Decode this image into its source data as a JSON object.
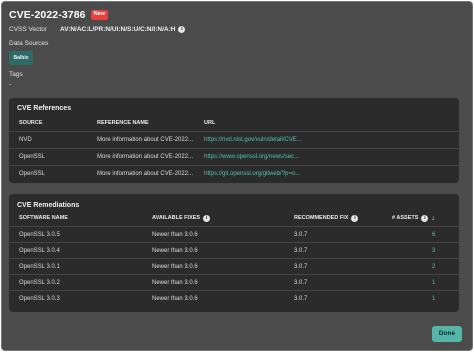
{
  "header": {
    "title": "CVE-2022-3786",
    "badge": "New"
  },
  "cvss": {
    "label": "CVSS Vector",
    "value": "AV:N/AC:L/PR:N/UI:N/S:U/C:N/I:N/A:H"
  },
  "data_sources": {
    "label": "Data Sources",
    "chip": "Balbix"
  },
  "tags": {
    "label": "Tags",
    "value": "-"
  },
  "references": {
    "title": "CVE References",
    "columns": [
      "SOURCE",
      "REFERENCE NAME",
      "URL"
    ],
    "rows": [
      {
        "source": "NVD",
        "name": "More information about CVE-2022...",
        "url": "https://nvd.nist.gov/vuln/detail/CVE..."
      },
      {
        "source": "OpenSSL",
        "name": "More information about CVE-2022...",
        "url": "https://www.openssl.org/news/sec..."
      },
      {
        "source": "OpenSSL",
        "name": "More information about CVE-2022...",
        "url": "https://git.openssl.org/gitweb/?p=o..."
      }
    ]
  },
  "remediations": {
    "title": "CVE Remediations",
    "columns": [
      "SOFTWARE NAME",
      "AVAILABLE FIXES",
      "RECOMMENDED FIX",
      "# ASSETS"
    ],
    "rows": [
      {
        "software": "OpenSSL 3.0.5",
        "fixes": "Newer than 3.0.6",
        "recommended": "3.0.7",
        "assets": "6"
      },
      {
        "software": "OpenSSL 3.0.4",
        "fixes": "Newer than 3.0.6",
        "recommended": "3.0.7",
        "assets": "3"
      },
      {
        "software": "OpenSSL 3.0.1",
        "fixes": "Newer than 3.0.6",
        "recommended": "3.0.7",
        "assets": "2"
      },
      {
        "software": "OpenSSL 3.0.2",
        "fixes": "Newer than 3.0.6",
        "recommended": "3.0.7",
        "assets": "1"
      },
      {
        "software": "OpenSSL 3.0.3",
        "fixes": "Newer than 3.0.6",
        "recommended": "3.0.7",
        "assets": "1"
      }
    ]
  },
  "footer": {
    "done_label": "Done"
  },
  "colors": {
    "accent": "#4fc3b2",
    "badge": "#e8423f",
    "panel": "#2b2b2b",
    "modal": "#4b4b4b"
  },
  "icons": {
    "info": "info-icon",
    "sort": "arrow-down-icon"
  }
}
